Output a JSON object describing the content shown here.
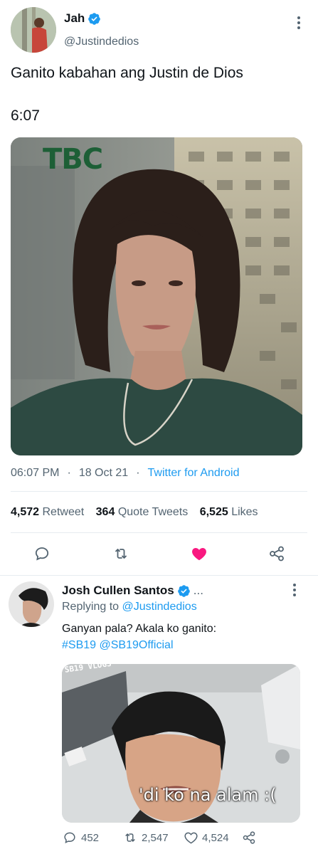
{
  "tweet": {
    "author_name": "Jah",
    "author_handle": "@Justindedios",
    "text": "Ganito kabahan ang Justin de Dios",
    "text2": "6:07",
    "photo_overlay": "TBC",
    "time": "06:07 PM",
    "sep1": "·",
    "date": "18 Oct 21",
    "sep2": "·",
    "source": "Twitter for Android",
    "retweets_count": "4,572",
    "retweets_label": "Retweet",
    "quotes_count": "364",
    "quotes_label": "Quote Tweets",
    "likes_count": "6,525",
    "likes_label": "Likes"
  },
  "reply": {
    "author_name": "Josh Cullen Santos",
    "more": "...",
    "replying_prefix": "Replying to",
    "replying_handle": "@Justindedios",
    "text": "Ganyan pala? Akala ko ganito:",
    "hashtag": "#SB19",
    "mention": "@SB19Official",
    "image_caption": "'di ko na alam :(",
    "image_overlay": "SB19 VLOGS",
    "replies": "452",
    "retweets": "2,547",
    "likes": "4,524"
  },
  "colors": {
    "accent": "#1d9bf0",
    "like": "#f91880",
    "muted": "#536471"
  }
}
